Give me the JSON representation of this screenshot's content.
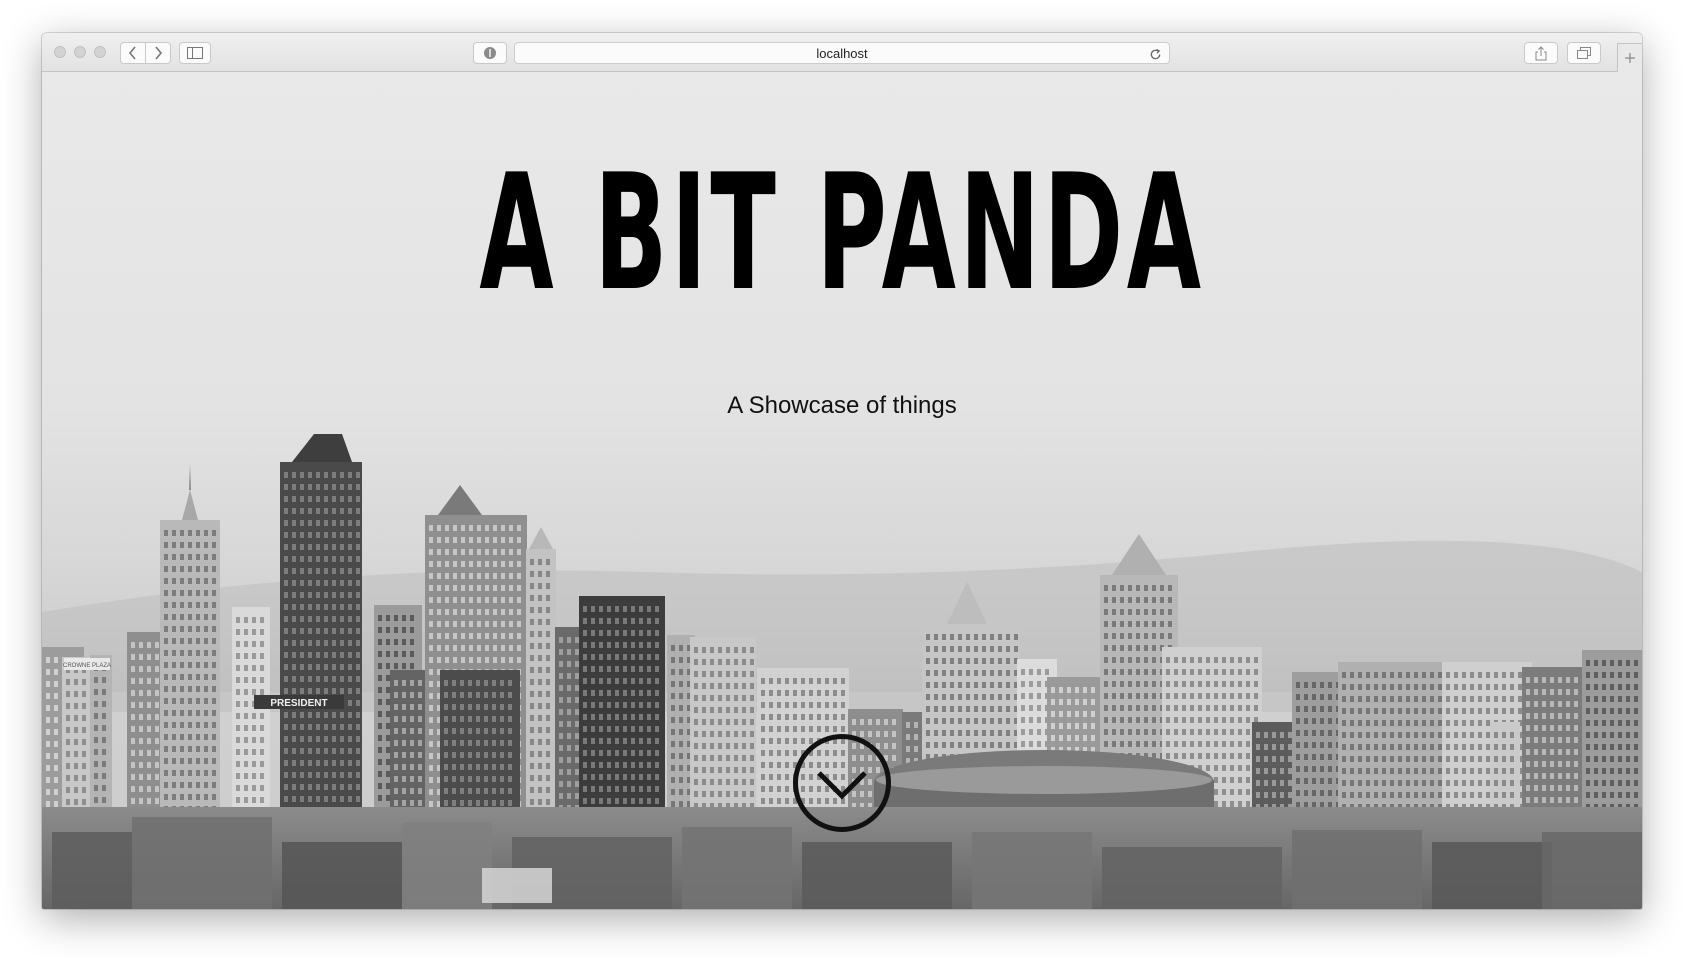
{
  "browser": {
    "url": "localhost",
    "icons": {
      "close": "close-dot-icon",
      "minimize": "minimize-dot-icon",
      "zoom": "zoom-dot-icon",
      "back": "chevron-left-icon",
      "forward": "chevron-right-icon",
      "sidebar": "sidebar-icon",
      "privacy": "privacy-shield-icon",
      "reload": "reload-icon",
      "share": "share-icon",
      "tabs": "tabs-overview-icon",
      "new_tab": "plus-icon"
    }
  },
  "hero": {
    "title": "A BIT PANDA",
    "subtitle": "A Showcase of things",
    "scroll_icon": "chevron-down-circle-icon",
    "background": "city-skyline-photo",
    "signs": {
      "hotel": "CROWNE PLAZA",
      "president": "PRESIDENT"
    }
  },
  "colors": {
    "title": "#000000",
    "subtitle": "#111111",
    "sky_top": "#e9e9e9",
    "sky_bottom": "#c9c9c9"
  }
}
